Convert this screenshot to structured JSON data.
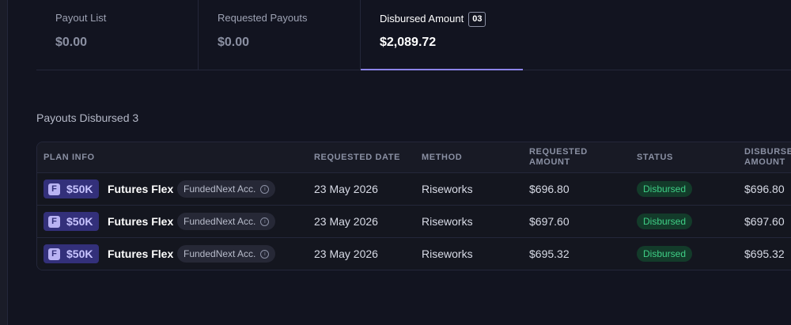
{
  "summary": {
    "tabs": [
      {
        "label": "Payout List",
        "value": "$0.00"
      },
      {
        "label": "Requested Payouts",
        "value": "$0.00"
      },
      {
        "label": "Disbursed Amount",
        "badge": "03",
        "value": "$2,089.72"
      }
    ]
  },
  "section": {
    "title": "Payouts Disbursed 3"
  },
  "table": {
    "headers": {
      "plan_info": "PLAN INFO",
      "requested_date": "REQUESTED DATE",
      "method": "METHOD",
      "requested_amount_l1": "REQUESTED",
      "requested_amount_l2": "AMOUNT",
      "status": "STATUS",
      "disbursed_amount_l1": "DISBURSED",
      "disbursed_amount_l2": "AMOUNT"
    },
    "rows": [
      {
        "plan_icon": "F",
        "plan_size": "$50K",
        "plan_name": "Futures Flex",
        "account": "FundedNext Acc.",
        "date": "23 May 2026",
        "method": "Riseworks",
        "requested_amount": "$696.80",
        "status": "Disbursed",
        "disbursed_amount": "$696.80"
      },
      {
        "plan_icon": "F",
        "plan_size": "$50K",
        "plan_name": "Futures Flex",
        "account": "FundedNext Acc.",
        "date": "23 May 2026",
        "method": "Riseworks",
        "requested_amount": "$697.60",
        "status": "Disbursed",
        "disbursed_amount": "$697.60"
      },
      {
        "plan_icon": "F",
        "plan_size": "$50K",
        "plan_name": "Futures Flex",
        "account": "FundedNext Acc.",
        "date": "23 May 2026",
        "method": "Riseworks",
        "requested_amount": "$695.32",
        "status": "Disbursed",
        "disbursed_amount": "$695.32"
      }
    ]
  },
  "colors": {
    "accent": "#8c84e8",
    "status_disbursed": "#3fcf86",
    "plan_chip": "#33307a"
  },
  "icons": {
    "plan": "futures-plan-icon",
    "info": "info-icon"
  }
}
